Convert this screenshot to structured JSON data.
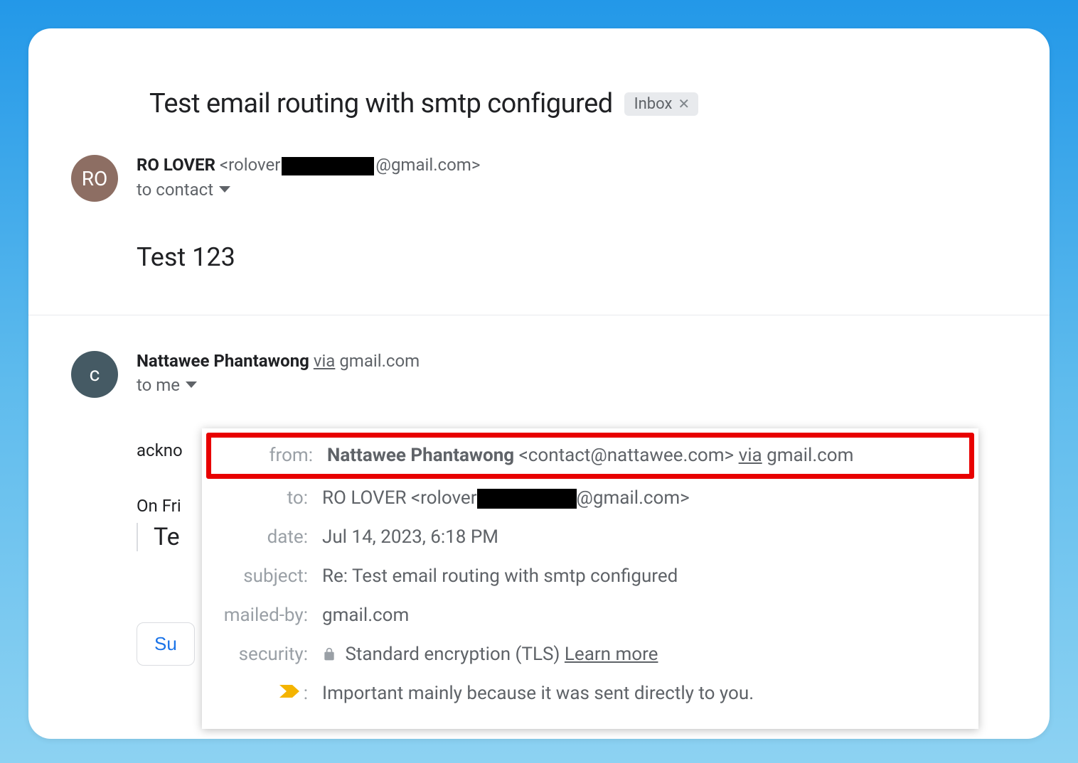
{
  "subject": "Test email routing with smtp configured",
  "inbox_chip": {
    "label": "Inbox"
  },
  "message1": {
    "avatar_initials": "RO",
    "sender_name": "RO LOVER",
    "sender_email_prefix": "<rolover",
    "sender_email_suffix": "@gmail.com>",
    "to_line": "to contact",
    "body": "Test 123"
  },
  "message2": {
    "avatar_initials": "c",
    "sender_name": "Nattawee Phantawong",
    "via_label": "via",
    "via_domain": "gmail.com",
    "to_line": "to me",
    "partial_body": "ackno",
    "quoted_prefix": "On Fri",
    "quoted_body": "Te",
    "suggest_button": "Su"
  },
  "details": {
    "from": {
      "key": "from:",
      "name": "Nattawee Phantawong",
      "email": "<contact@nattawee.com>",
      "via_label": "via",
      "via_domain": "gmail.com"
    },
    "to": {
      "key": "to:",
      "prefix": "RO LOVER <rolover",
      "suffix": "@gmail.com>"
    },
    "date": {
      "key": "date:",
      "value": "Jul 14, 2023, 6:18 PM"
    },
    "subject_row": {
      "key": "subject:",
      "value": "Re: Test email routing with smtp configured"
    },
    "mailed_by": {
      "key": "mailed-by:",
      "value": "gmail.com"
    },
    "security": {
      "key": "security:",
      "value": "Standard encryption (TLS)",
      "learn_more": "Learn more"
    },
    "importance": {
      "key": ":",
      "value": "Important mainly because it was sent directly to you."
    }
  }
}
